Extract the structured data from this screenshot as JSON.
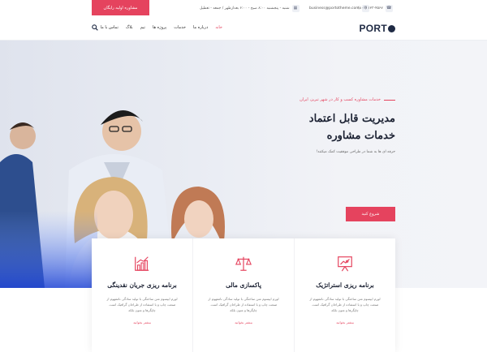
{
  "topbar": {
    "cta_label": "مشاوره اولیه رایگان",
    "phone": "(۸۰۰) ۱۲۳-۴۵۶۷",
    "email": "business@portotheme.com",
    "hours": "شنبه - پنجشنبه ۸:۰۰ صبح - ۶:۰۰ بعدازظهر / جمعه - تعطیل"
  },
  "nav": {
    "logo": "PORT",
    "items": [
      "خانه",
      "درباره ما",
      "خدمات",
      "پروژه ها",
      "تیم",
      "بلاگ",
      "تماس با ما"
    ]
  },
  "hero": {
    "eyebrow": "خدمات مشاوره کسب و کار در شهر تبریز، ایران",
    "title_line1": "مدیریت قابل اعتماد",
    "title_line2": "خدمات مشاوره",
    "description": "حرفه ای ها به شما در طراحی موفقیت کمک میکنند!",
    "button_label": "شروع کنید"
  },
  "cards": [
    {
      "icon": "presentation-chart-icon",
      "title": "برنامه ریزی استراتژیک",
      "description": "لورم ایپسوم متن ساختگی با تولید سادگی نامفهوم از صنعت چاپ و با استفاده از طراحان گرافیک است. چاپگرها و متون بلکه",
      "link": "بیشتر بخوانید"
    },
    {
      "icon": "balance-scale-icon",
      "title": "پاکسازی مالی",
      "description": "لورم ایپسوم متن ساختگی با تولید سادگی نامفهوم از صنعت چاپ و با استفاده از طراحان گرافیک است. چاپگرها و متون بلکه",
      "link": "بیشتر بخوانید"
    },
    {
      "icon": "growth-chart-icon",
      "title": "برنامه ریزی جریان نقدینگی",
      "description": "لورم ایپسوم متن ساختگی با تولید سادگی نامفهوم از صنعت چاپ و با استفاده از طراحان گرافیک است. چاپگرها و متون بلکه",
      "link": "بیشتر بخوانید"
    }
  ],
  "colors": {
    "accent": "#e5435e",
    "navy": "#1f2a44"
  }
}
